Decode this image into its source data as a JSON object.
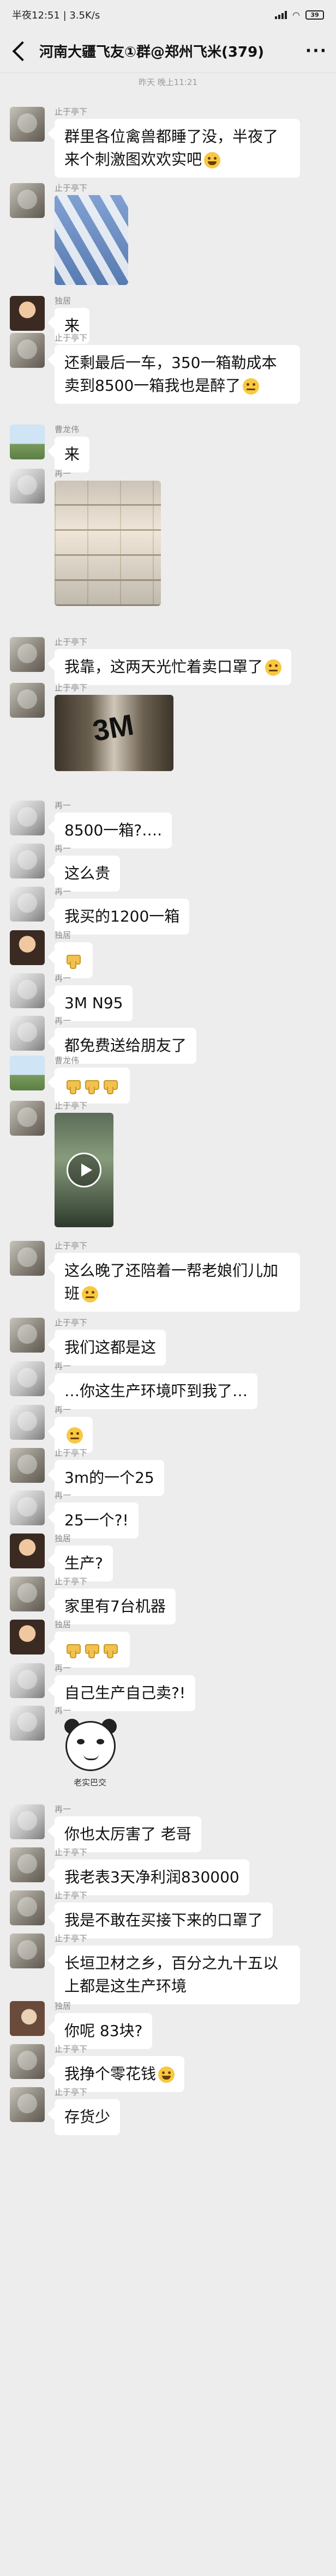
{
  "status_bar": {
    "left_text": "半夜12:51 | 3.5K/s",
    "battery": "39"
  },
  "header": {
    "title": "河南大疆飞友①群@郑州飞米(379)",
    "more_icon": "more-icon"
  },
  "timestamp": "昨天 晚上11:21",
  "messages": [
    {
      "sender": "止于亭下",
      "type": "text",
      "text": "群里各位禽兽都睡了没，半夜了来个刺激图欢欢实吧",
      "emoji": "grin"
    },
    {
      "sender": "止于亭下",
      "type": "image",
      "image": "masks-photo"
    },
    {
      "sender": "独居",
      "type": "text",
      "text": "来"
    },
    {
      "sender": "止于亭下",
      "type": "text",
      "text": "还剩最后一车，350一箱勒成本卖到8500一箱我也是醉了",
      "emoji": "sweat"
    },
    {
      "sender": "曹龙伟",
      "type": "text",
      "text": "来"
    },
    {
      "sender": "再一",
      "type": "image",
      "image": "boxes-photo"
    },
    {
      "sender": "止于亭下",
      "type": "text",
      "text": "我靠，这两天光忙着卖口罩了",
      "emoji": "sweat"
    },
    {
      "sender": "止于亭下",
      "type": "image",
      "image": "3m-photo",
      "image_text": "3M"
    },
    {
      "sender": "再一",
      "type": "text",
      "text": "8500一箱?…."
    },
    {
      "sender": "再一",
      "type": "text",
      "text": "这么贵"
    },
    {
      "sender": "再一",
      "type": "text",
      "text": "我买的1200一箱"
    },
    {
      "sender": "独居",
      "type": "thumbs",
      "count": 1
    },
    {
      "sender": "再一",
      "type": "text",
      "text": "3M N95"
    },
    {
      "sender": "再一",
      "type": "text",
      "text": "都免费送给朋友了"
    },
    {
      "sender": "曹龙伟",
      "type": "thumbs",
      "count": 3
    },
    {
      "sender": "止于亭下",
      "type": "video",
      "image": "video-thumbnail"
    },
    {
      "sender": "止于亭下",
      "type": "text",
      "text": "这么晚了还陪着一帮老娘们儿加班",
      "emoji": "sweat"
    },
    {
      "sender": "止于亭下",
      "type": "text",
      "text": "我们这都是这"
    },
    {
      "sender": "再一",
      "type": "text",
      "text": "…你这生产环境吓到我了…"
    },
    {
      "sender": "再一",
      "type": "emoji_only",
      "emoji": "sweat"
    },
    {
      "sender": "止于亭下",
      "type": "text",
      "text": "3m的一个25"
    },
    {
      "sender": "再一",
      "type": "text",
      "text": "25一个?!"
    },
    {
      "sender": "独居",
      "type": "text",
      "text": "生产?"
    },
    {
      "sender": "止于亭下",
      "type": "text",
      "text": "家里有7台机器"
    },
    {
      "sender": "独居",
      "type": "thumbs",
      "count": 3
    },
    {
      "sender": "再一",
      "type": "text",
      "text": "自己生产自己卖?!"
    },
    {
      "sender": "再一",
      "type": "sticker",
      "caption": "老实巴交"
    },
    {
      "sender": "再一",
      "type": "text",
      "text": "你也太厉害了 老哥"
    },
    {
      "sender": "止于亭下",
      "type": "text",
      "text": "我老表3天净利润830000"
    },
    {
      "sender": "止于亭下",
      "type": "text",
      "text": "我是不敢在买接下来的口罩了"
    },
    {
      "sender": "止于亭下",
      "type": "text",
      "text": "长垣卫材之乡，百分之九十五以上都是这生产环境"
    },
    {
      "sender": "独居",
      "type": "text",
      "text": "你呢 83块?"
    },
    {
      "sender": "止于亭下",
      "type": "text",
      "text": "我挣个零花钱",
      "emoji": "grin"
    },
    {
      "sender": "止于亭下",
      "type": "text",
      "text": "存货少"
    }
  ]
}
